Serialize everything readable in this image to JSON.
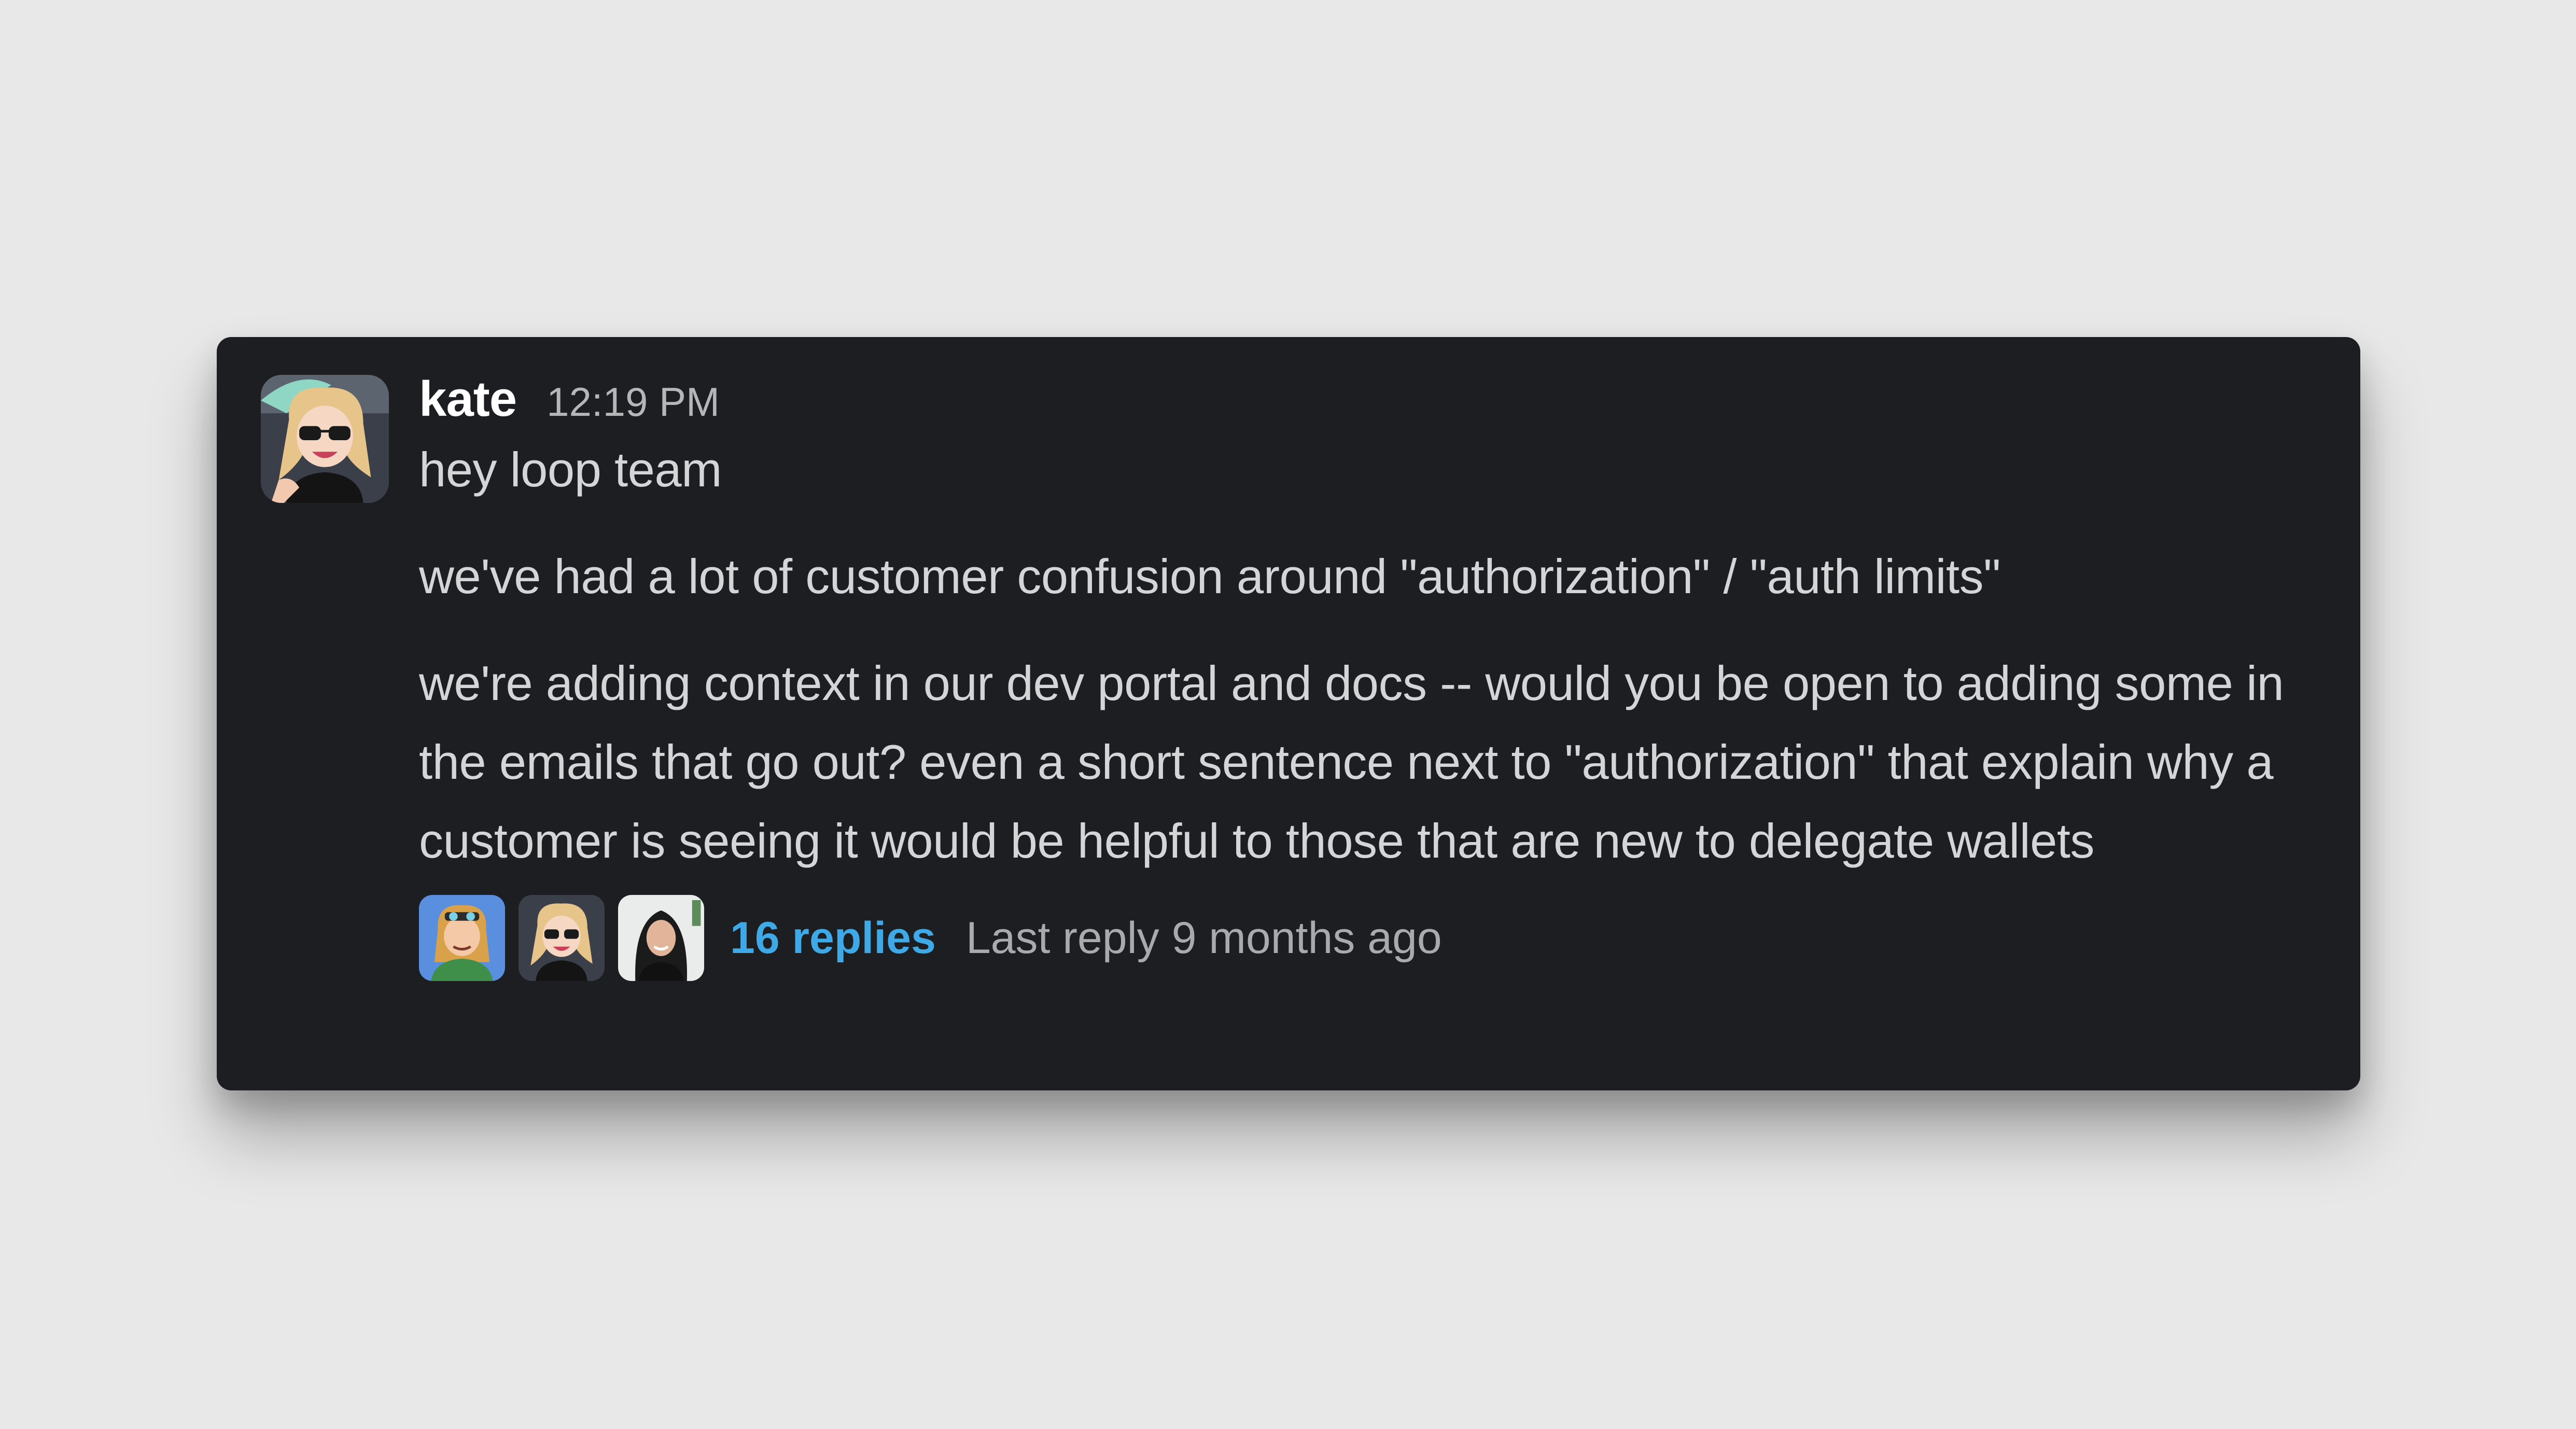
{
  "message": {
    "author": "kate",
    "timestamp": "12:19 PM",
    "lines": [
      "hey loop team",
      "we've had a lot of customer confusion around \"authorization\" / \"auth limits\"",
      "we're adding context in our dev portal and docs -- would you be open to adding some in the emails that go out? even a short sentence next to \"authorization\" that explain why a customer is seeing it would be helpful to those that are new to delegate wallets"
    ]
  },
  "thread": {
    "replies_label": "16 replies",
    "last_reply_label": "Last reply 9 months ago"
  },
  "colors": {
    "background": "#e8e8e8",
    "card": "#1d1e21",
    "link": "#3ea9e6"
  }
}
